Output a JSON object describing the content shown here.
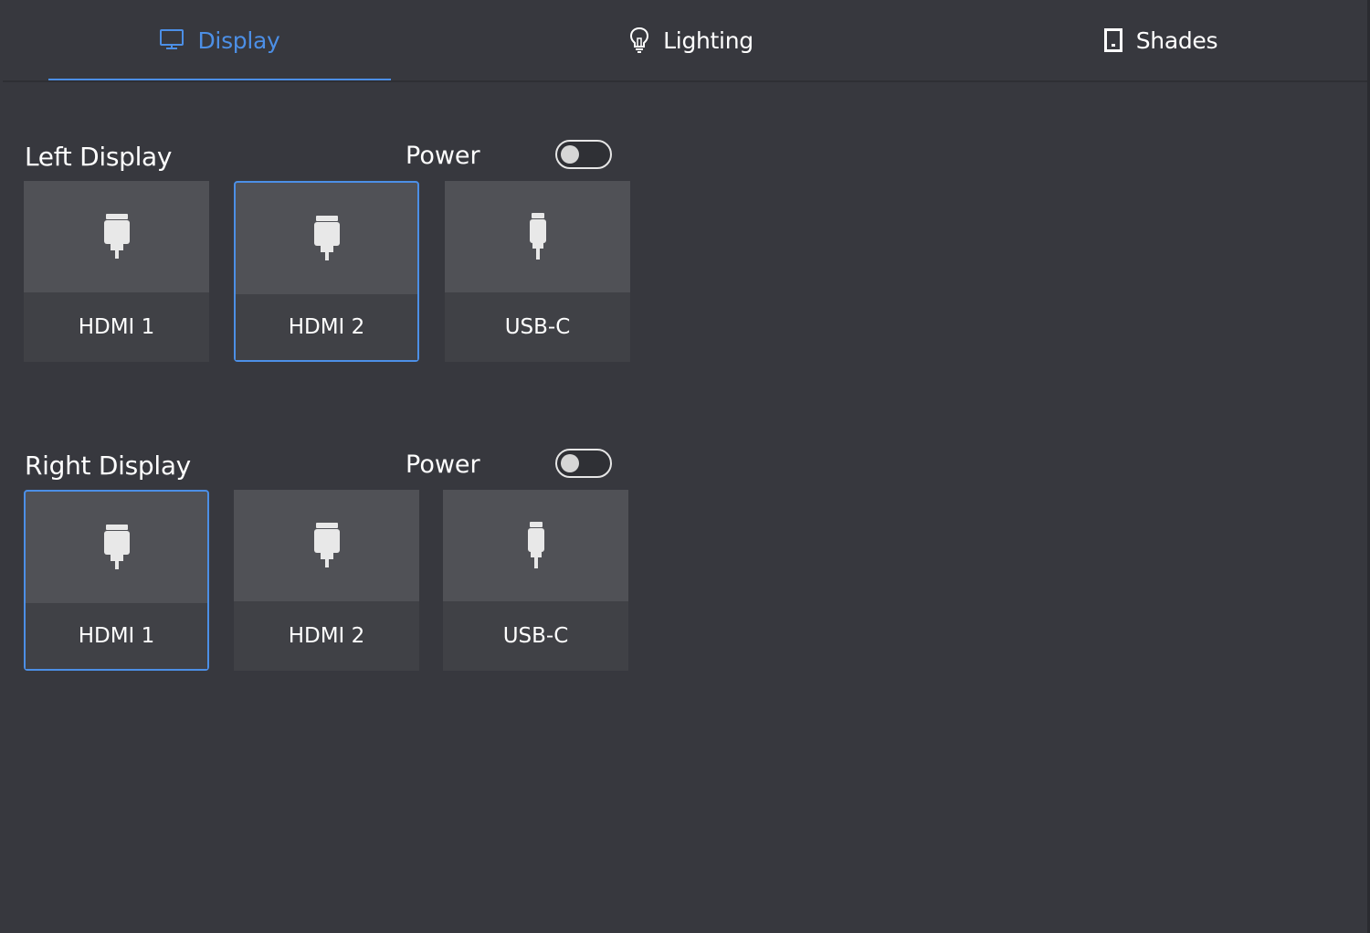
{
  "tabs": [
    {
      "label": "Display",
      "icon": "monitor-icon",
      "active": true
    },
    {
      "label": "Lighting",
      "icon": "lightbulb-icon",
      "active": false
    },
    {
      "label": "Shades",
      "icon": "shade-icon",
      "active": false
    }
  ],
  "colors": {
    "accent": "#4c8fe6",
    "background": "#37383e",
    "card_top": "#505156",
    "card_bottom": "#404146"
  },
  "displays": [
    {
      "title": "Left Display",
      "power_label": "Power",
      "power_on": false,
      "sources": [
        {
          "label": "HDMI 1",
          "icon": "hdmi-plug-icon",
          "selected": false
        },
        {
          "label": "HDMI 2",
          "icon": "hdmi-plug-icon",
          "selected": true
        },
        {
          "label": "USB-C",
          "icon": "usb-c-plug-icon",
          "selected": false
        }
      ]
    },
    {
      "title": "Right Display",
      "power_label": "Power",
      "power_on": false,
      "sources": [
        {
          "label": "HDMI 1",
          "icon": "hdmi-plug-icon",
          "selected": true
        },
        {
          "label": "HDMI 2",
          "icon": "hdmi-plug-icon",
          "selected": false
        },
        {
          "label": "USB-C",
          "icon": "usb-c-plug-icon",
          "selected": false
        }
      ]
    }
  ]
}
